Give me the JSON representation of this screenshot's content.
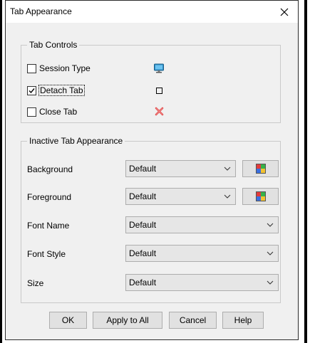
{
  "dialog": {
    "title": "Tab Appearance",
    "close_icon": "close-icon"
  },
  "tab_controls": {
    "legend": "Tab Controls",
    "items": [
      {
        "label": "Session Type",
        "checked": false,
        "icon": "monitor-icon"
      },
      {
        "label": "Detach Tab",
        "checked": true,
        "icon": "restore-window-icon"
      },
      {
        "label": "Close Tab",
        "checked": false,
        "icon": "red-x-icon"
      }
    ]
  },
  "inactive_appearance": {
    "legend": "Inactive Tab Appearance",
    "fields": [
      {
        "label": "Background",
        "value": "Default",
        "has_color_button": true
      },
      {
        "label": "Foreground",
        "value": "Default",
        "has_color_button": true
      },
      {
        "label": "Font Name",
        "value": "Default",
        "has_color_button": false
      },
      {
        "label": "Font Style",
        "value": "Default",
        "has_color_button": false
      },
      {
        "label": "Size",
        "value": "Default",
        "has_color_button": false
      }
    ],
    "color_button_icon": "color-palette-icon"
  },
  "buttons": {
    "ok": "OK",
    "apply_all": "Apply to All",
    "cancel": "Cancel",
    "help": "Help"
  }
}
